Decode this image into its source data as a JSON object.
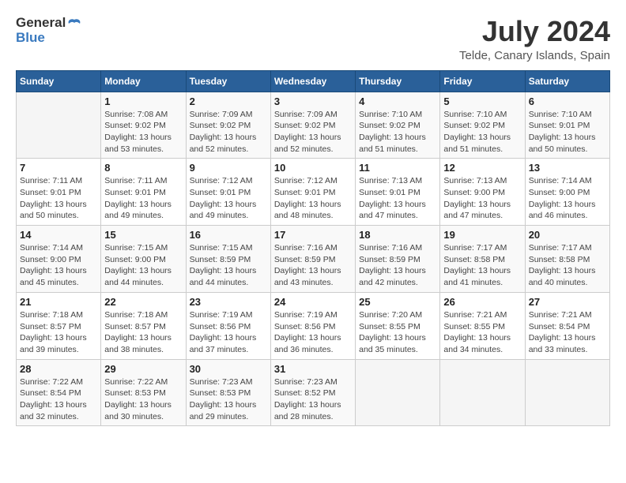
{
  "header": {
    "logo_general": "General",
    "logo_blue": "Blue",
    "month_year": "July 2024",
    "location": "Telde, Canary Islands, Spain"
  },
  "days_of_week": [
    "Sunday",
    "Monday",
    "Tuesday",
    "Wednesday",
    "Thursday",
    "Friday",
    "Saturday"
  ],
  "weeks": [
    [
      {
        "day": "",
        "info": ""
      },
      {
        "day": "1",
        "info": "Sunrise: 7:08 AM\nSunset: 9:02 PM\nDaylight: 13 hours\nand 53 minutes."
      },
      {
        "day": "2",
        "info": "Sunrise: 7:09 AM\nSunset: 9:02 PM\nDaylight: 13 hours\nand 52 minutes."
      },
      {
        "day": "3",
        "info": "Sunrise: 7:09 AM\nSunset: 9:02 PM\nDaylight: 13 hours\nand 52 minutes."
      },
      {
        "day": "4",
        "info": "Sunrise: 7:10 AM\nSunset: 9:02 PM\nDaylight: 13 hours\nand 51 minutes."
      },
      {
        "day": "5",
        "info": "Sunrise: 7:10 AM\nSunset: 9:02 PM\nDaylight: 13 hours\nand 51 minutes."
      },
      {
        "day": "6",
        "info": "Sunrise: 7:10 AM\nSunset: 9:01 PM\nDaylight: 13 hours\nand 50 minutes."
      }
    ],
    [
      {
        "day": "7",
        "info": "Sunrise: 7:11 AM\nSunset: 9:01 PM\nDaylight: 13 hours\nand 50 minutes."
      },
      {
        "day": "8",
        "info": "Sunrise: 7:11 AM\nSunset: 9:01 PM\nDaylight: 13 hours\nand 49 minutes."
      },
      {
        "day": "9",
        "info": "Sunrise: 7:12 AM\nSunset: 9:01 PM\nDaylight: 13 hours\nand 49 minutes."
      },
      {
        "day": "10",
        "info": "Sunrise: 7:12 AM\nSunset: 9:01 PM\nDaylight: 13 hours\nand 48 minutes."
      },
      {
        "day": "11",
        "info": "Sunrise: 7:13 AM\nSunset: 9:01 PM\nDaylight: 13 hours\nand 47 minutes."
      },
      {
        "day": "12",
        "info": "Sunrise: 7:13 AM\nSunset: 9:00 PM\nDaylight: 13 hours\nand 47 minutes."
      },
      {
        "day": "13",
        "info": "Sunrise: 7:14 AM\nSunset: 9:00 PM\nDaylight: 13 hours\nand 46 minutes."
      }
    ],
    [
      {
        "day": "14",
        "info": "Sunrise: 7:14 AM\nSunset: 9:00 PM\nDaylight: 13 hours\nand 45 minutes."
      },
      {
        "day": "15",
        "info": "Sunrise: 7:15 AM\nSunset: 9:00 PM\nDaylight: 13 hours\nand 44 minutes."
      },
      {
        "day": "16",
        "info": "Sunrise: 7:15 AM\nSunset: 8:59 PM\nDaylight: 13 hours\nand 44 minutes."
      },
      {
        "day": "17",
        "info": "Sunrise: 7:16 AM\nSunset: 8:59 PM\nDaylight: 13 hours\nand 43 minutes."
      },
      {
        "day": "18",
        "info": "Sunrise: 7:16 AM\nSunset: 8:59 PM\nDaylight: 13 hours\nand 42 minutes."
      },
      {
        "day": "19",
        "info": "Sunrise: 7:17 AM\nSunset: 8:58 PM\nDaylight: 13 hours\nand 41 minutes."
      },
      {
        "day": "20",
        "info": "Sunrise: 7:17 AM\nSunset: 8:58 PM\nDaylight: 13 hours\nand 40 minutes."
      }
    ],
    [
      {
        "day": "21",
        "info": "Sunrise: 7:18 AM\nSunset: 8:57 PM\nDaylight: 13 hours\nand 39 minutes."
      },
      {
        "day": "22",
        "info": "Sunrise: 7:18 AM\nSunset: 8:57 PM\nDaylight: 13 hours\nand 38 minutes."
      },
      {
        "day": "23",
        "info": "Sunrise: 7:19 AM\nSunset: 8:56 PM\nDaylight: 13 hours\nand 37 minutes."
      },
      {
        "day": "24",
        "info": "Sunrise: 7:19 AM\nSunset: 8:56 PM\nDaylight: 13 hours\nand 36 minutes."
      },
      {
        "day": "25",
        "info": "Sunrise: 7:20 AM\nSunset: 8:55 PM\nDaylight: 13 hours\nand 35 minutes."
      },
      {
        "day": "26",
        "info": "Sunrise: 7:21 AM\nSunset: 8:55 PM\nDaylight: 13 hours\nand 34 minutes."
      },
      {
        "day": "27",
        "info": "Sunrise: 7:21 AM\nSunset: 8:54 PM\nDaylight: 13 hours\nand 33 minutes."
      }
    ],
    [
      {
        "day": "28",
        "info": "Sunrise: 7:22 AM\nSunset: 8:54 PM\nDaylight: 13 hours\nand 32 minutes."
      },
      {
        "day": "29",
        "info": "Sunrise: 7:22 AM\nSunset: 8:53 PM\nDaylight: 13 hours\nand 30 minutes."
      },
      {
        "day": "30",
        "info": "Sunrise: 7:23 AM\nSunset: 8:53 PM\nDaylight: 13 hours\nand 29 minutes."
      },
      {
        "day": "31",
        "info": "Sunrise: 7:23 AM\nSunset: 8:52 PM\nDaylight: 13 hours\nand 28 minutes."
      },
      {
        "day": "",
        "info": ""
      },
      {
        "day": "",
        "info": ""
      },
      {
        "day": "",
        "info": ""
      }
    ]
  ]
}
